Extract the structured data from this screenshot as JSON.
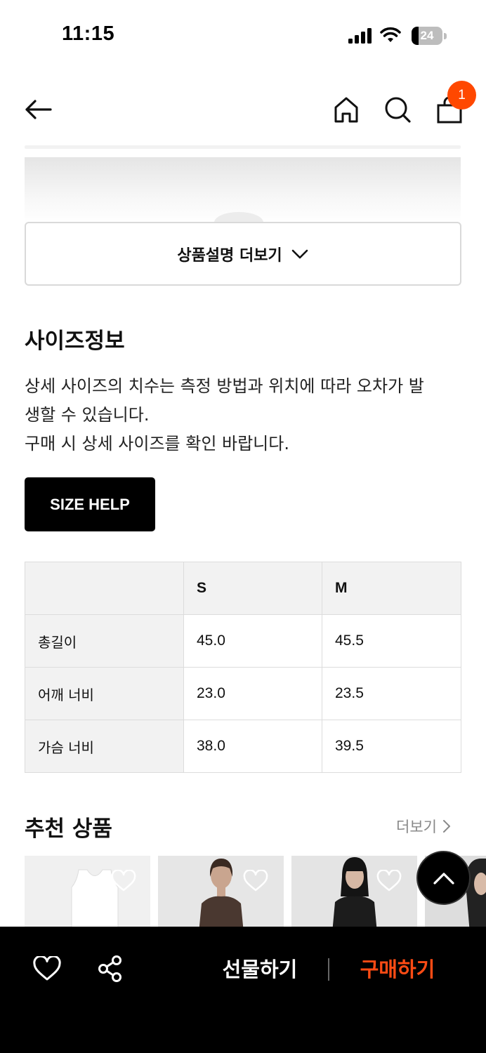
{
  "status_bar": {
    "time": "11:15",
    "battery": "24"
  },
  "header": {
    "cart_count": "1"
  },
  "more_description": {
    "label": "상품설명 더보기"
  },
  "size_info": {
    "title": "사이즈정보",
    "desc_line1": "상세 사이즈의 치수는 측정 방법과 위치에 따라 오차가 발",
    "desc_line2": "생할 수 있습니다.",
    "desc_line3": "구매 시 상세 사이즈를 확인 바랍니다.",
    "help_button": "SIZE HELP",
    "table": {
      "columns": [
        "",
        "S",
        "M"
      ],
      "rows": [
        {
          "label": "총길이",
          "values": [
            "45.0",
            "45.5"
          ]
        },
        {
          "label": "어깨 너비",
          "values": [
            "23.0",
            "23.5"
          ]
        },
        {
          "label": "가슴 너비",
          "values": [
            "38.0",
            "39.5"
          ]
        }
      ]
    }
  },
  "recommended": {
    "title": "추천 상품",
    "more_label": "더보기"
  },
  "bottom_bar": {
    "gift_label": "선물하기",
    "buy_label": "구매하기",
    "accent_color": "#ff4b14"
  }
}
